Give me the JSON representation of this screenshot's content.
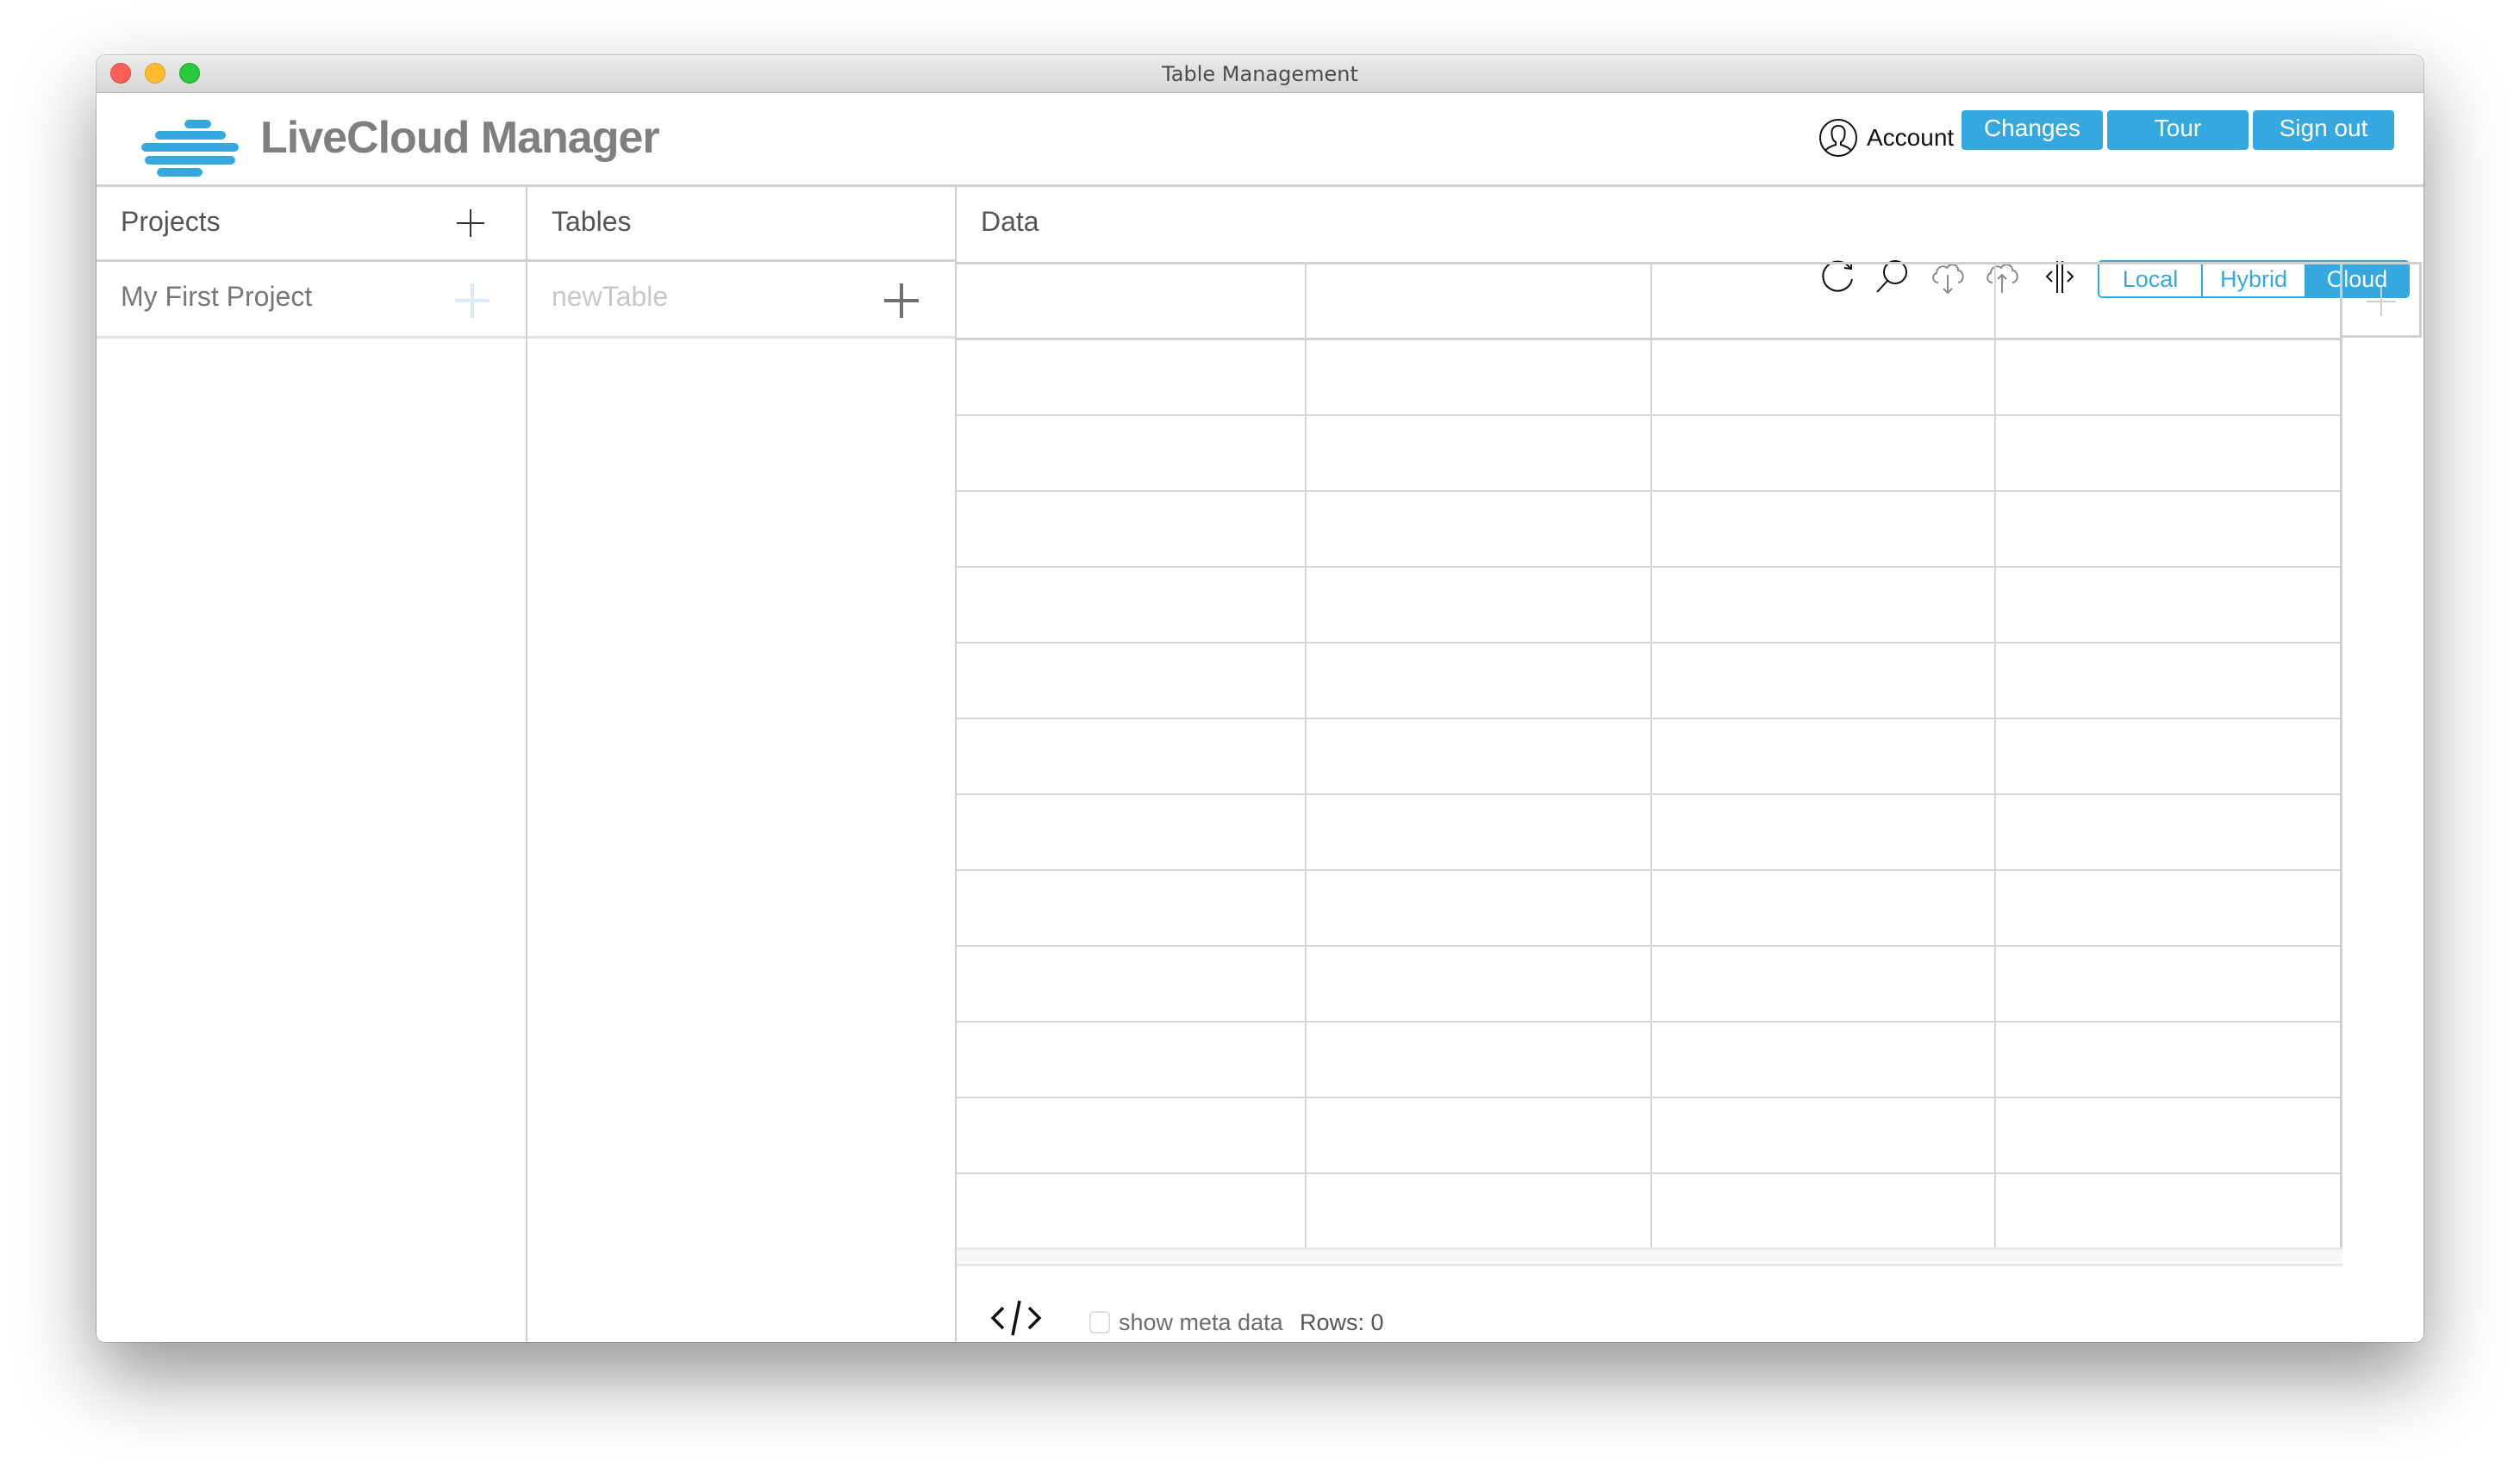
{
  "window": {
    "title": "Table Management"
  },
  "header": {
    "brand": "LiveCloud Manager",
    "account_label": "Account",
    "buttons": [
      {
        "id": "changes",
        "label": "Changes"
      },
      {
        "id": "tour",
        "label": "Tour"
      },
      {
        "id": "sign-out",
        "label": "Sign out"
      }
    ],
    "accent_color": "#35a9df"
  },
  "projects": {
    "title": "Projects",
    "items": [
      {
        "label": "My First Project",
        "selected": true
      }
    ]
  },
  "tables": {
    "title": "Tables",
    "items": [
      {
        "label": "newTable",
        "placeholder": true
      }
    ]
  },
  "data": {
    "title": "Data",
    "toolbar": {
      "icons": [
        "refresh-icon",
        "search-icon",
        "cloud-download-icon",
        "cloud-upload-icon",
        "split-columns-icon"
      ]
    },
    "mode": {
      "options": [
        "Local",
        "Hybrid",
        "Cloud"
      ],
      "selected": "Cloud"
    },
    "grid": {
      "columns": [
        "",
        "",
        "",
        ""
      ],
      "rows": [
        [
          "",
          "",
          "",
          ""
        ],
        [
          "",
          "",
          "",
          ""
        ],
        [
          "",
          "",
          "",
          ""
        ],
        [
          "",
          "",
          "",
          ""
        ],
        [
          "",
          "",
          "",
          ""
        ],
        [
          "",
          "",
          "",
          ""
        ],
        [
          "",
          "",
          "",
          ""
        ],
        [
          "",
          "",
          "",
          ""
        ],
        [
          "",
          "",
          "",
          ""
        ],
        [
          "",
          "",
          "",
          ""
        ],
        [
          "",
          "",
          "",
          ""
        ],
        [
          "",
          "",
          "",
          ""
        ]
      ]
    },
    "footer": {
      "show_meta_label": "show meta data",
      "show_meta_checked": false,
      "rows_label": "Rows: 0"
    }
  }
}
